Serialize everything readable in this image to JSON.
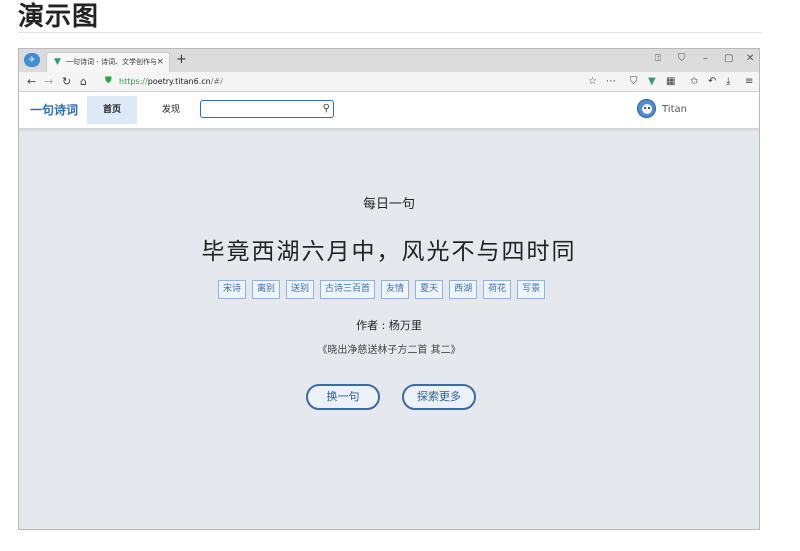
{
  "doc": {
    "heading": "演示图"
  },
  "browser": {
    "tab_title": "一句诗词 - 诗词、文学创作与",
    "tab_close": "×",
    "new_tab": "+",
    "url_scheme": "https://",
    "url_host": "poetry.titan6.cn",
    "url_path": "/#/"
  },
  "site": {
    "logo": "一句诗词",
    "nav": {
      "home": "首页",
      "discover": "发现"
    },
    "search": {
      "value": "",
      "placeholder": ""
    },
    "user": {
      "name": "Titan"
    }
  },
  "main": {
    "heading": "每日一句",
    "poem_line": "毕竟西湖六月中，风光不与四时同",
    "tags": [
      "宋诗",
      "离别",
      "送别",
      "古诗三百首",
      "友情",
      "夏天",
      "西湖",
      "荷花",
      "写景"
    ],
    "author": "作者 : 杨万里",
    "source": "《晓出净慈送林子方二首 其二》",
    "buttons": {
      "next": "换一句",
      "explore": "探索更多"
    }
  },
  "colors": {
    "accent": "#2c6fb8",
    "tag_border": "#8fb3db",
    "content_bg": "#e5e8ec",
    "secure_green": "#2aa34a"
  }
}
